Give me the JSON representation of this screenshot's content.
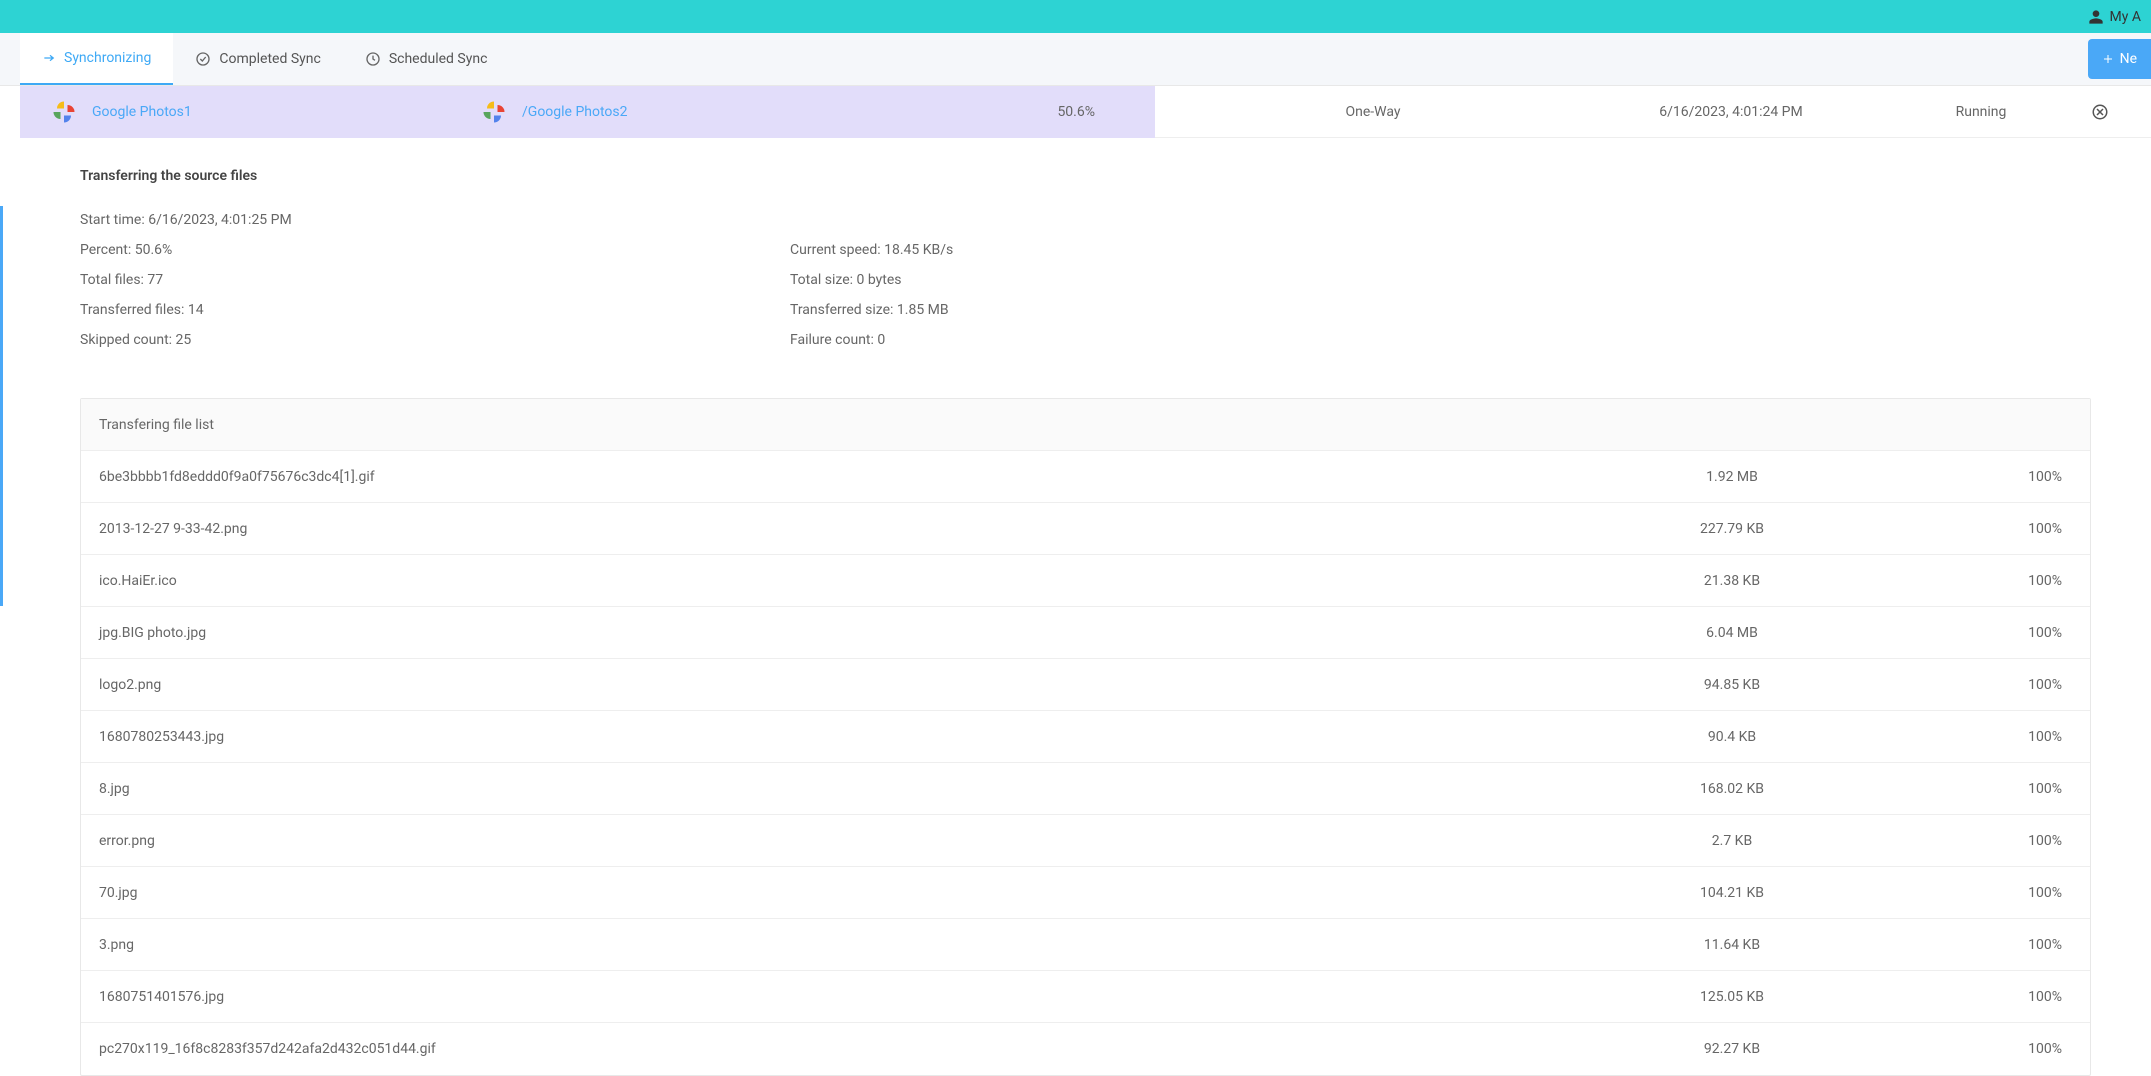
{
  "topbar": {
    "user_label": "My A"
  },
  "tabs": {
    "synchronizing": "Synchronizing",
    "completed": "Completed Sync",
    "scheduled": "Scheduled Sync"
  },
  "new_button": "Ne",
  "sync_row": {
    "source": "Google Photos1",
    "dest": "/Google Photos2",
    "percent": "50.6%",
    "mode": "One-Way",
    "datetime": "6/16/2023, 4:01:24 PM",
    "status": "Running"
  },
  "details": {
    "heading": "Transferring the source files",
    "start_time": "Start time: 6/16/2023, 4:01:25 PM",
    "percent": "Percent: 50.6%",
    "total_files": "Total files: 77",
    "transferred_files": "Transferred files: 14",
    "skipped_count": "Skipped count: 25",
    "current_speed": "Current speed: 18.45 KB/s",
    "total_size": "Total size: 0 bytes",
    "transferred_size": "Transferred size: 1.85 MB",
    "failure_count": "Failure count: 0"
  },
  "file_list": {
    "header": "Transfering file list",
    "rows": [
      {
        "name": "6be3bbbb1fd8eddd0f9a0f75676c3dc4[1].gif",
        "size": "1.92 MB",
        "progress": "100%"
      },
      {
        "name": "2013-12-27 9-33-42.png",
        "size": "227.79 KB",
        "progress": "100%"
      },
      {
        "name": "ico.HaiEr.ico",
        "size": "21.38 KB",
        "progress": "100%"
      },
      {
        "name": "jpg.BIG photo.jpg",
        "size": "6.04 MB",
        "progress": "100%"
      },
      {
        "name": "logo2.png",
        "size": "94.85 KB",
        "progress": "100%"
      },
      {
        "name": "1680780253443.jpg",
        "size": "90.4 KB",
        "progress": "100%"
      },
      {
        "name": "8.jpg",
        "size": "168.02 KB",
        "progress": "100%"
      },
      {
        "name": "error.png",
        "size": "2.7 KB",
        "progress": "100%"
      },
      {
        "name": "70.jpg",
        "size": "104.21 KB",
        "progress": "100%"
      },
      {
        "name": "3.png",
        "size": "11.64 KB",
        "progress": "100%"
      },
      {
        "name": "1680751401576.jpg",
        "size": "125.05 KB",
        "progress": "100%"
      },
      {
        "name": "pc270x119_16f8c8283f357d242afa2d432c051d44.gif",
        "size": "92.27 KB",
        "progress": "100%"
      }
    ]
  }
}
